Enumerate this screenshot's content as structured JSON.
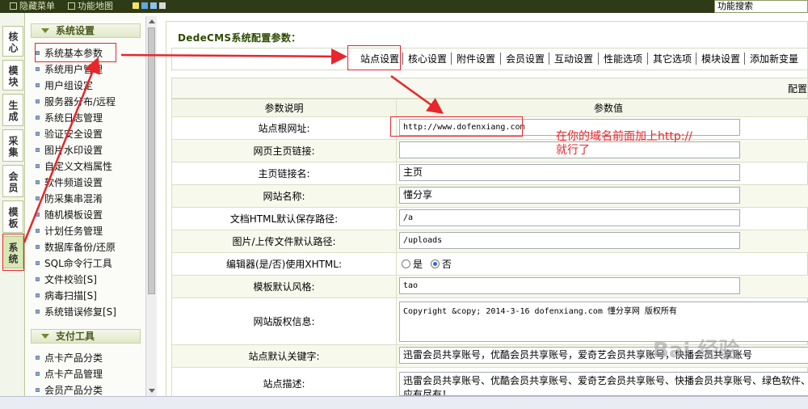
{
  "topbar": {
    "hide_menu": "隐藏菜单",
    "site_map": "功能地图",
    "search_label": "功能搜索"
  },
  "sidebar_tabs": [
    {
      "label": "核心"
    },
    {
      "label": "模块"
    },
    {
      "label": "生成"
    },
    {
      "label": "采集"
    },
    {
      "label": "会员"
    },
    {
      "label": "模板"
    },
    {
      "label": "系统",
      "active": true
    }
  ],
  "menu": {
    "system_header": "系统设置",
    "system_items": [
      "系统基本参数",
      "系统用户管理",
      "用户组设定",
      "服务器分布/远程",
      "系统日志管理",
      "验证安全设置",
      "图片水印设置",
      "自定义文档属性",
      "软件频道设置",
      "防采集串混淆",
      "随机模板设置",
      "计划任务管理",
      "数据库备份/还原",
      "SQL命令行工具",
      "文件校验[S]",
      "病毒扫描[S]",
      "系统错误修复[S]"
    ],
    "pay_header": "支付工具",
    "pay_items": [
      "点卡产品分类",
      "点卡产品管理",
      "会员产品分类"
    ]
  },
  "main": {
    "title": "DedeCMS系统配置参数：",
    "tabs": [
      "站点设置",
      "核心设置",
      "附件设置",
      "会员设置",
      "互动设置",
      "性能选项",
      "其它选项",
      "模块设置",
      "添加新变量"
    ],
    "config_label": "配置:",
    "col_param": "参数说明",
    "col_value": "参数值",
    "rows": {
      "site_root": {
        "label": "站点根网址:",
        "value": "http://www.dofenxiang.com"
      },
      "home_link": {
        "label": "网页主页链接:",
        "value": ""
      },
      "home_name": {
        "label": "主页链接名:",
        "value": "主页"
      },
      "site_name": {
        "label": "网站名称:",
        "value": "懂分享"
      },
      "html_path": {
        "label": "文档HTML默认保存路径:",
        "value": "/a"
      },
      "upload_path": {
        "label": "图片/上传文件默认路径:",
        "value": "/uploads"
      },
      "xhtml_editor": {
        "label": "编辑器(是/否)使用XHTML:",
        "yes": "是",
        "no": "否"
      },
      "template_style": {
        "label": "模板默认风格:",
        "value": "tao"
      },
      "copyright": {
        "label": "网站版权信息:",
        "value": "Copyright &copy; 2014-3-16 dofenxiang.com 懂分享网 版权所有"
      },
      "keywords": {
        "label": "站点默认关键字:",
        "value": "迅雷会员共享账号，优酷会员共享账号，爱奇艺会员共享账号，快播会员共享账号"
      },
      "description": {
        "label": "站点描述:",
        "value": "迅雷会员共享账号、优酷会员共享账号、爱奇艺会员共享账号、快播会员共享账号、绿色软件、应有尽有！"
      }
    }
  },
  "annotation": {
    "line1": "在你的域名前面加上http://",
    "line2": "就行了",
    "color": "#e8262b"
  },
  "watermark": "Bai 经验"
}
